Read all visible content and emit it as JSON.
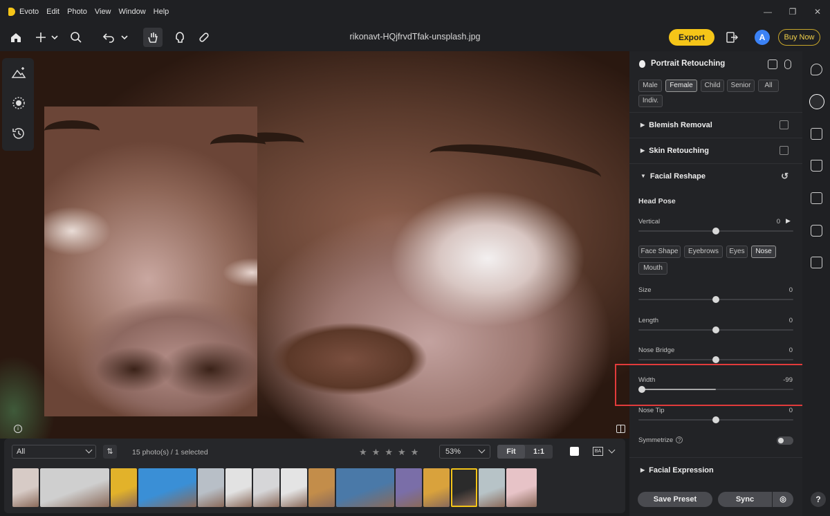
{
  "app": {
    "name": "Evoto"
  },
  "menu": [
    "Edit",
    "Photo",
    "View",
    "Window",
    "Help"
  ],
  "toolbar": {
    "filename": "rikonavt-HQjfrvdTfak-unsplash.jpg",
    "export_label": "Export",
    "avatar_letter": "A",
    "buy_label": "Buy Now"
  },
  "filmstrip": {
    "filter": "All",
    "count_text": "15 photo(s) / 1 selected",
    "zoom": "53%",
    "fit_label": "Fit",
    "onetoone_label": "1:1",
    "ba_label": "BA",
    "thumbs": [
      {
        "color": "#d7cbc6",
        "w": 38
      },
      {
        "color": "#cfcfcf",
        "w": 100
      },
      {
        "color": "#e2b22a",
        "w": 38
      },
      {
        "color": "#3a8fd6",
        "w": 84
      },
      {
        "color": "#b8bfc7",
        "w": 38
      },
      {
        "color": "#e2e2e2",
        "w": 38
      },
      {
        "color": "#d6d6d8",
        "w": 38
      },
      {
        "color": "#e4e4e4",
        "w": 38
      },
      {
        "color": "#c38d4a",
        "w": 38
      },
      {
        "color": "#4a79a8",
        "w": 84
      },
      {
        "color": "#7a6ea8",
        "w": 38
      },
      {
        "color": "#d9a23c",
        "w": 38
      },
      {
        "color": "#2b2b2b",
        "w": 38,
        "active": true
      },
      {
        "color": "#b7c3c7",
        "w": 38
      },
      {
        "color": "#e7c3c7",
        "w": 44
      }
    ]
  },
  "panel": {
    "title": "Portrait Retouching",
    "gender_chips": [
      "Male",
      "Female",
      "Child",
      "Senior",
      "All",
      "Indiv."
    ],
    "selected_gender": "Female",
    "sections": {
      "blemish": "Blemish Removal",
      "skin": "Skin Retouching",
      "reshape": "Facial Reshape",
      "expression": "Facial Expression"
    },
    "head_pose": "Head Pose",
    "vertical": {
      "label": "Vertical",
      "value": "0",
      "level": 0.5
    },
    "feature_chips": [
      "Face Shape",
      "Eyebrows",
      "Eyes",
      "Nose",
      "Mouth"
    ],
    "selected_feature": "Nose",
    "sliders": [
      {
        "label": "Size",
        "value": "0",
        "level": 0.5
      },
      {
        "label": "Length",
        "value": "0",
        "level": 0.5
      },
      {
        "label": "Nose Bridge",
        "value": "0",
        "level": 0.5
      },
      {
        "label": "Width",
        "value": "-99",
        "level": 0.005
      },
      {
        "label": "Nose Tip",
        "value": "0",
        "level": 0.5
      }
    ],
    "symmetrize": "Symmetrize",
    "save_preset": "Save Preset",
    "sync": "Sync"
  },
  "rail_icons": [
    "palette-icon",
    "face-icon",
    "mosaic-icon",
    "shirt-icon",
    "crop-icon",
    "camera-icon",
    "folder-eye-icon"
  ]
}
